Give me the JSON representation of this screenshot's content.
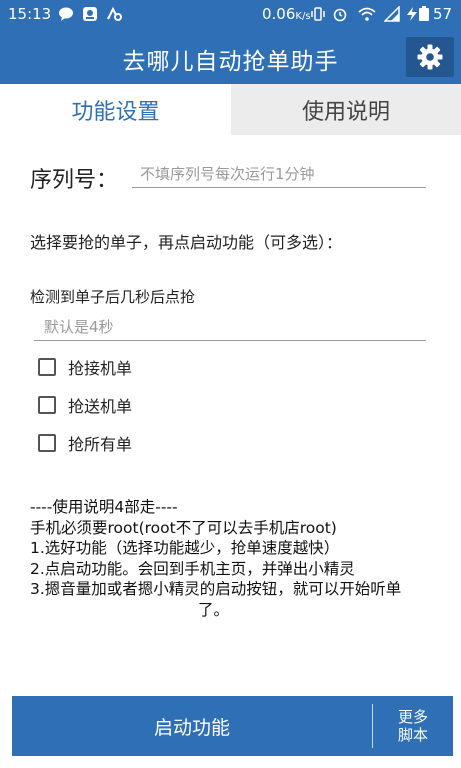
{
  "status_bar": {
    "time": "15:13",
    "network_speed": "0.06",
    "network_unit": "K/s",
    "battery": "57"
  },
  "app_bar": {
    "title": "去哪儿自动抢单助手",
    "settings_icon": "gear-icon"
  },
  "tabs": [
    {
      "label": "功能设置",
      "active": true
    },
    {
      "label": "使用说明",
      "active": false
    }
  ],
  "serial": {
    "label": "序列号：",
    "placeholder": "不填序列号每次运行1分钟",
    "value": ""
  },
  "choose_text": "选择要抢的单子，再点启动功能（可多选）：",
  "delay": {
    "label": "检测到单子后几秒后点抢",
    "placeholder": "默认是4秒",
    "value": ""
  },
  "options": [
    {
      "label": "抢接机单",
      "checked": false
    },
    {
      "label": "抢送机单",
      "checked": false
    },
    {
      "label": "抢所有单",
      "checked": false
    }
  ],
  "instructions": [
    "----使用说明4部走----",
    "手机必须要root(root不了可以去手机店root)",
    "1.选好功能（选择功能越少，抢单速度越快）",
    "2.点启动功能。会回到手机主页，并弹出小精灵",
    "3.摁音量加或者摁小精灵的启动按钮，就可以开始听单",
    "了。"
  ],
  "bottom": {
    "start_label": "启动功能",
    "more_line1": "更多",
    "more_line2": "脚本"
  },
  "colors": {
    "primary": "#2f6fb6",
    "primary_dark": "#24568f",
    "inactive_tab": "#ececec"
  }
}
